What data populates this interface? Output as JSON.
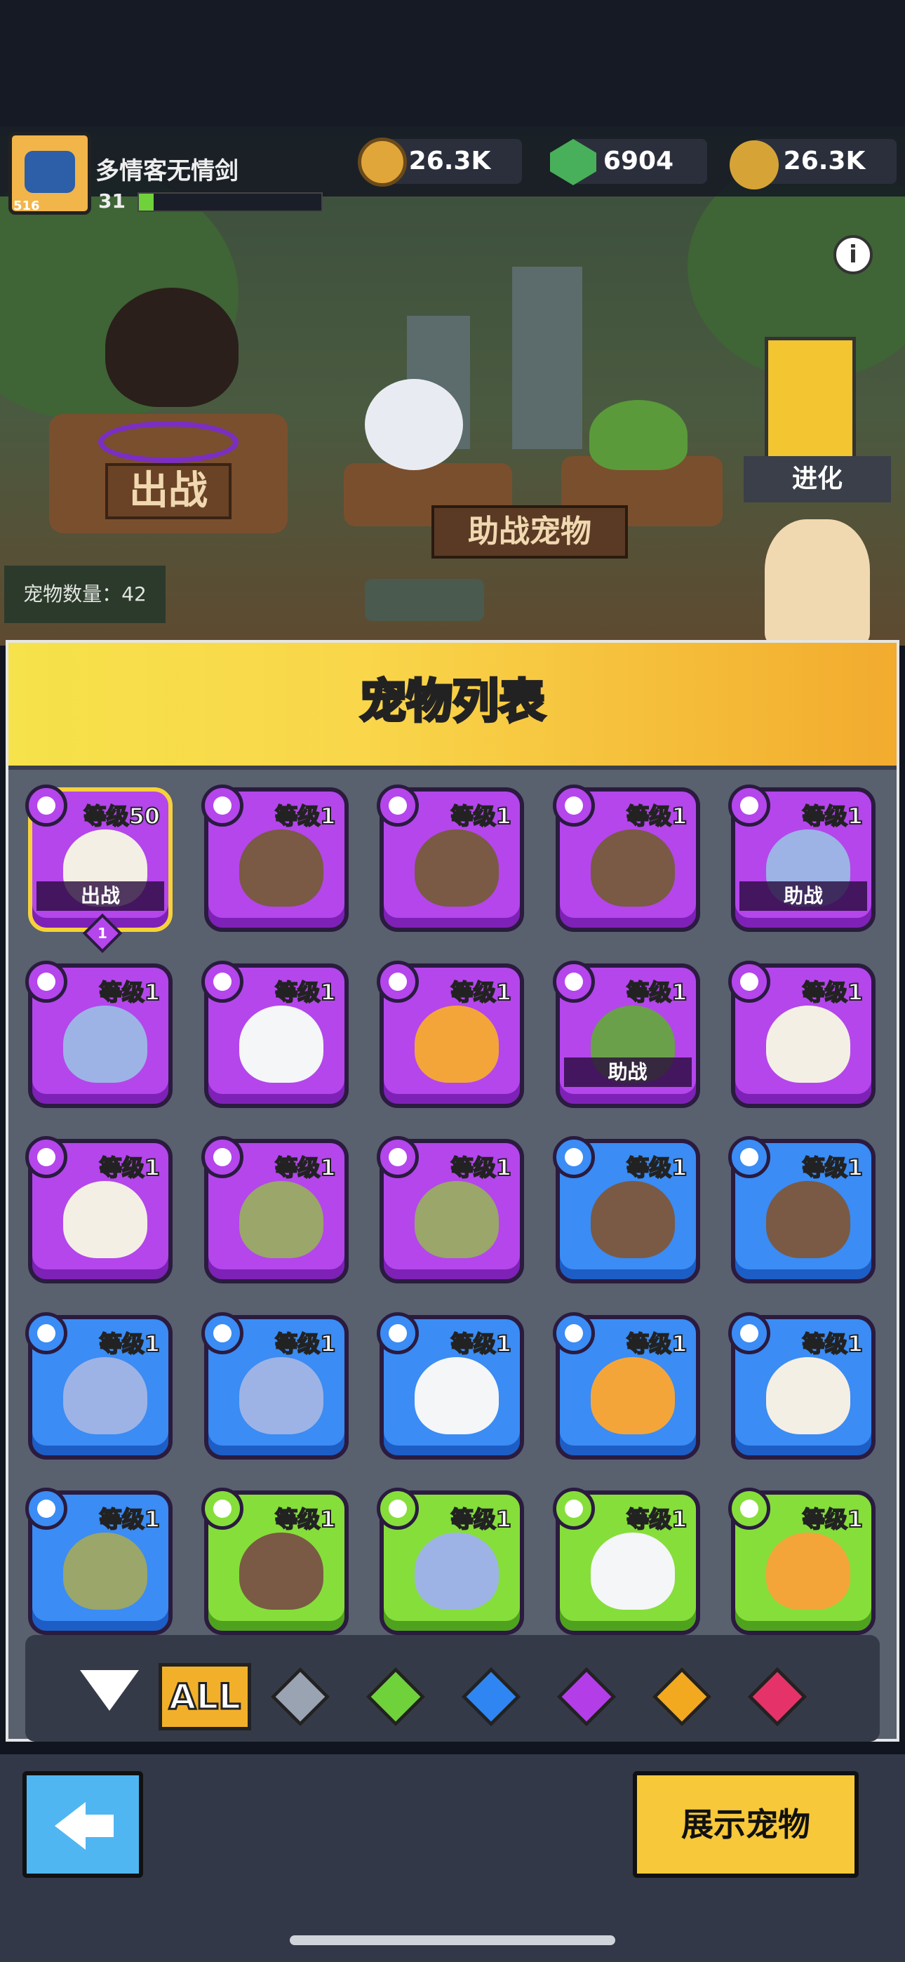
{
  "player": {
    "name": "多情客无情剑",
    "level": "31",
    "badge": "516"
  },
  "resources": [
    {
      "icon": "gold-coin-icon",
      "value": "26.3K"
    },
    {
      "icon": "green-gem-icon",
      "value": "6904"
    },
    {
      "icon": "gold-plus-icon",
      "value": "26.3K"
    }
  ],
  "scene": {
    "battle_label": "出战",
    "assist_label": "助战宠物",
    "evolve_label": "进化",
    "pet_count": "宠物数量：42"
  },
  "panel": {
    "title": "宠物列表"
  },
  "cards": [
    {
      "rarity": "purple",
      "level": "等级50",
      "pet": "eagle",
      "tag": "出战",
      "rank": "1"
    },
    {
      "rarity": "purple",
      "level": "等级1",
      "pet": "dog"
    },
    {
      "rarity": "purple",
      "level": "等级1",
      "pet": "dog"
    },
    {
      "rarity": "purple",
      "level": "等级1",
      "pet": "dog"
    },
    {
      "rarity": "purple",
      "level": "等级1",
      "pet": "cat",
      "tag": "助战"
    },
    {
      "rarity": "purple",
      "level": "等级1",
      "pet": "cat"
    },
    {
      "rarity": "purple",
      "level": "等级1",
      "pet": "robot"
    },
    {
      "rarity": "purple",
      "level": "等级1",
      "pet": "fish"
    },
    {
      "rarity": "purple",
      "level": "等级1",
      "pet": "turtle",
      "tag": "助战"
    },
    {
      "rarity": "purple",
      "level": "等级1",
      "pet": "eagle"
    },
    {
      "rarity": "purple",
      "level": "等级1",
      "pet": "eagle"
    },
    {
      "rarity": "purple",
      "level": "等级1",
      "pet": "frog"
    },
    {
      "rarity": "purple",
      "level": "等级1",
      "pet": "frog"
    },
    {
      "rarity": "blue",
      "level": "等级1",
      "pet": "dog"
    },
    {
      "rarity": "blue",
      "level": "等级1",
      "pet": "dog"
    },
    {
      "rarity": "blue",
      "level": "等级1",
      "pet": "cat"
    },
    {
      "rarity": "blue",
      "level": "等级1",
      "pet": "cat"
    },
    {
      "rarity": "blue",
      "level": "等级1",
      "pet": "robot"
    },
    {
      "rarity": "blue",
      "level": "等级1",
      "pet": "fish"
    },
    {
      "rarity": "blue",
      "level": "等级1",
      "pet": "eagle"
    },
    {
      "rarity": "blue",
      "level": "等级1",
      "pet": "frog"
    },
    {
      "rarity": "green",
      "level": "等级1",
      "pet": "dog"
    },
    {
      "rarity": "green",
      "level": "等级1",
      "pet": "cat"
    },
    {
      "rarity": "green",
      "level": "等级1",
      "pet": "robot"
    },
    {
      "rarity": "green",
      "level": "等级1",
      "pet": "fish"
    }
  ],
  "filter": {
    "collapse_icon": "triangle-down-icon",
    "all_label": "ALL",
    "gems": [
      {
        "name": "gray",
        "color": "#9aa3b2"
      },
      {
        "name": "green",
        "color": "#6fd23a"
      },
      {
        "name": "blue",
        "color": "#2f86f2"
      },
      {
        "name": "purple",
        "color": "#b33ee8"
      },
      {
        "name": "orange",
        "color": "#f3a91f"
      },
      {
        "name": "red",
        "color": "#e5336a"
      }
    ]
  },
  "buttons": {
    "back_icon": "arrow-left-icon",
    "show_label": "展示宠物"
  },
  "colors": {
    "purple": "#b446ec",
    "blue": "#3b8cf4",
    "green": "#86de3a",
    "accent": "#f6c83a"
  }
}
